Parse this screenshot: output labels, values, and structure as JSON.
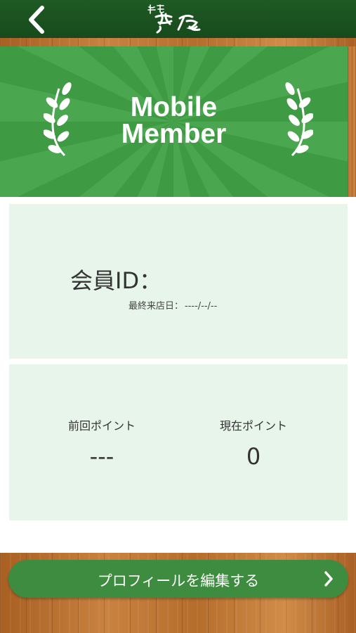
{
  "header": {
    "back_icon": "chevron-left-icon",
    "logo_text": "麺屋 茜香"
  },
  "banner": {
    "title_line1": "Mobile",
    "title_line2": "Member",
    "left_icon": "laurel-icon",
    "right_icon": "laurel-icon"
  },
  "member": {
    "id_label": "会員ID：",
    "id_value": "",
    "last_visit_label": "最終来店日：",
    "last_visit_value": "----/--/--"
  },
  "points": {
    "previous_label": "前回ポイント",
    "previous_value": "---",
    "current_label": "現在ポイント",
    "current_value": "0"
  },
  "footer": {
    "edit_profile_label": "プロフィールを編集する",
    "chevron_icon": "chevron-right-icon"
  },
  "colors": {
    "header_green": "#1f5a24",
    "banner_green": "#3f9a44",
    "card_bg": "#e8f5ea",
    "button_green": "#3d8c3f"
  }
}
